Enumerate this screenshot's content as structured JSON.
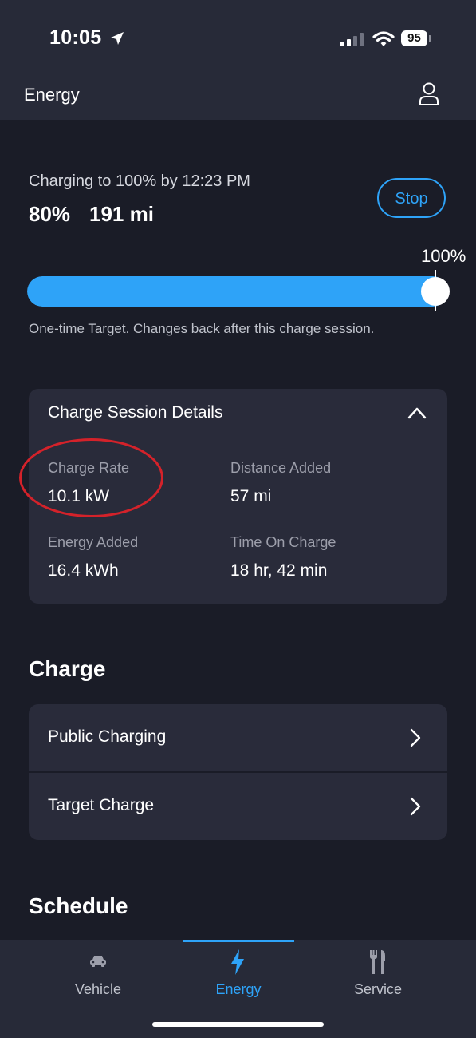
{
  "status_bar": {
    "time": "10:05",
    "battery": "95"
  },
  "app_bar": {
    "title": "Energy"
  },
  "charging": {
    "status": "Charging to 100% by 12:23 PM",
    "soc": "80%",
    "range": "191 mi",
    "stop_label": "Stop",
    "target_label": "100%",
    "current_level_fraction": 1.0,
    "note": "One-time Target. Changes back after this charge session."
  },
  "session": {
    "title": "Charge Session Details",
    "stats": [
      {
        "label": "Charge Rate",
        "value": "10.1 kW"
      },
      {
        "label": "Distance Added",
        "value": "57 mi"
      },
      {
        "label": "Energy Added",
        "value": "16.4 kWh"
      },
      {
        "label": "Time On Charge",
        "value": "18 hr, 42 min"
      }
    ]
  },
  "charge_section": {
    "title": "Charge",
    "items": [
      {
        "label": "Public Charging"
      },
      {
        "label": "Target Charge"
      }
    ]
  },
  "schedule_section": {
    "title": "Schedule"
  },
  "tabs": [
    {
      "label": "Vehicle",
      "icon": "car-icon",
      "active": false
    },
    {
      "label": "Energy",
      "icon": "bolt-icon",
      "active": true
    },
    {
      "label": "Service",
      "icon": "tools-icon",
      "active": false
    }
  ],
  "colors": {
    "accent": "#2ea3f8",
    "background": "#1a1c27",
    "card": "#292b3a",
    "highlight": "#d4222a"
  }
}
